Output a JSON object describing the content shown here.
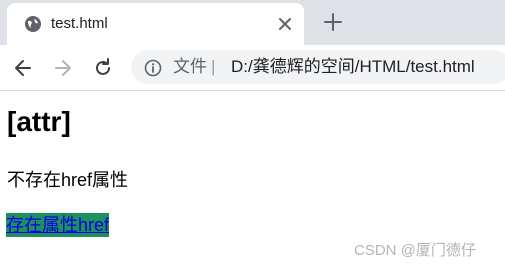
{
  "browser": {
    "tab": {
      "title": "test.html",
      "icon": "globe-icon"
    },
    "toolbar": {
      "back_icon": "arrow-left-icon",
      "forward_icon": "arrow-right-icon",
      "reload_icon": "reload-icon",
      "new_tab_icon": "plus-icon",
      "close_icon": "close-icon"
    },
    "omnibox": {
      "label": "文件",
      "separator": "|",
      "url": "D:/龚德辉的空间/HTML/test.html",
      "info_icon": "info-icon"
    }
  },
  "page": {
    "heading": "[attr]",
    "text": "不存在href属性",
    "link": "存在属性href",
    "link_highlight_color": "#1e8f5f"
  },
  "watermark": "CSDN @厦门德仔"
}
